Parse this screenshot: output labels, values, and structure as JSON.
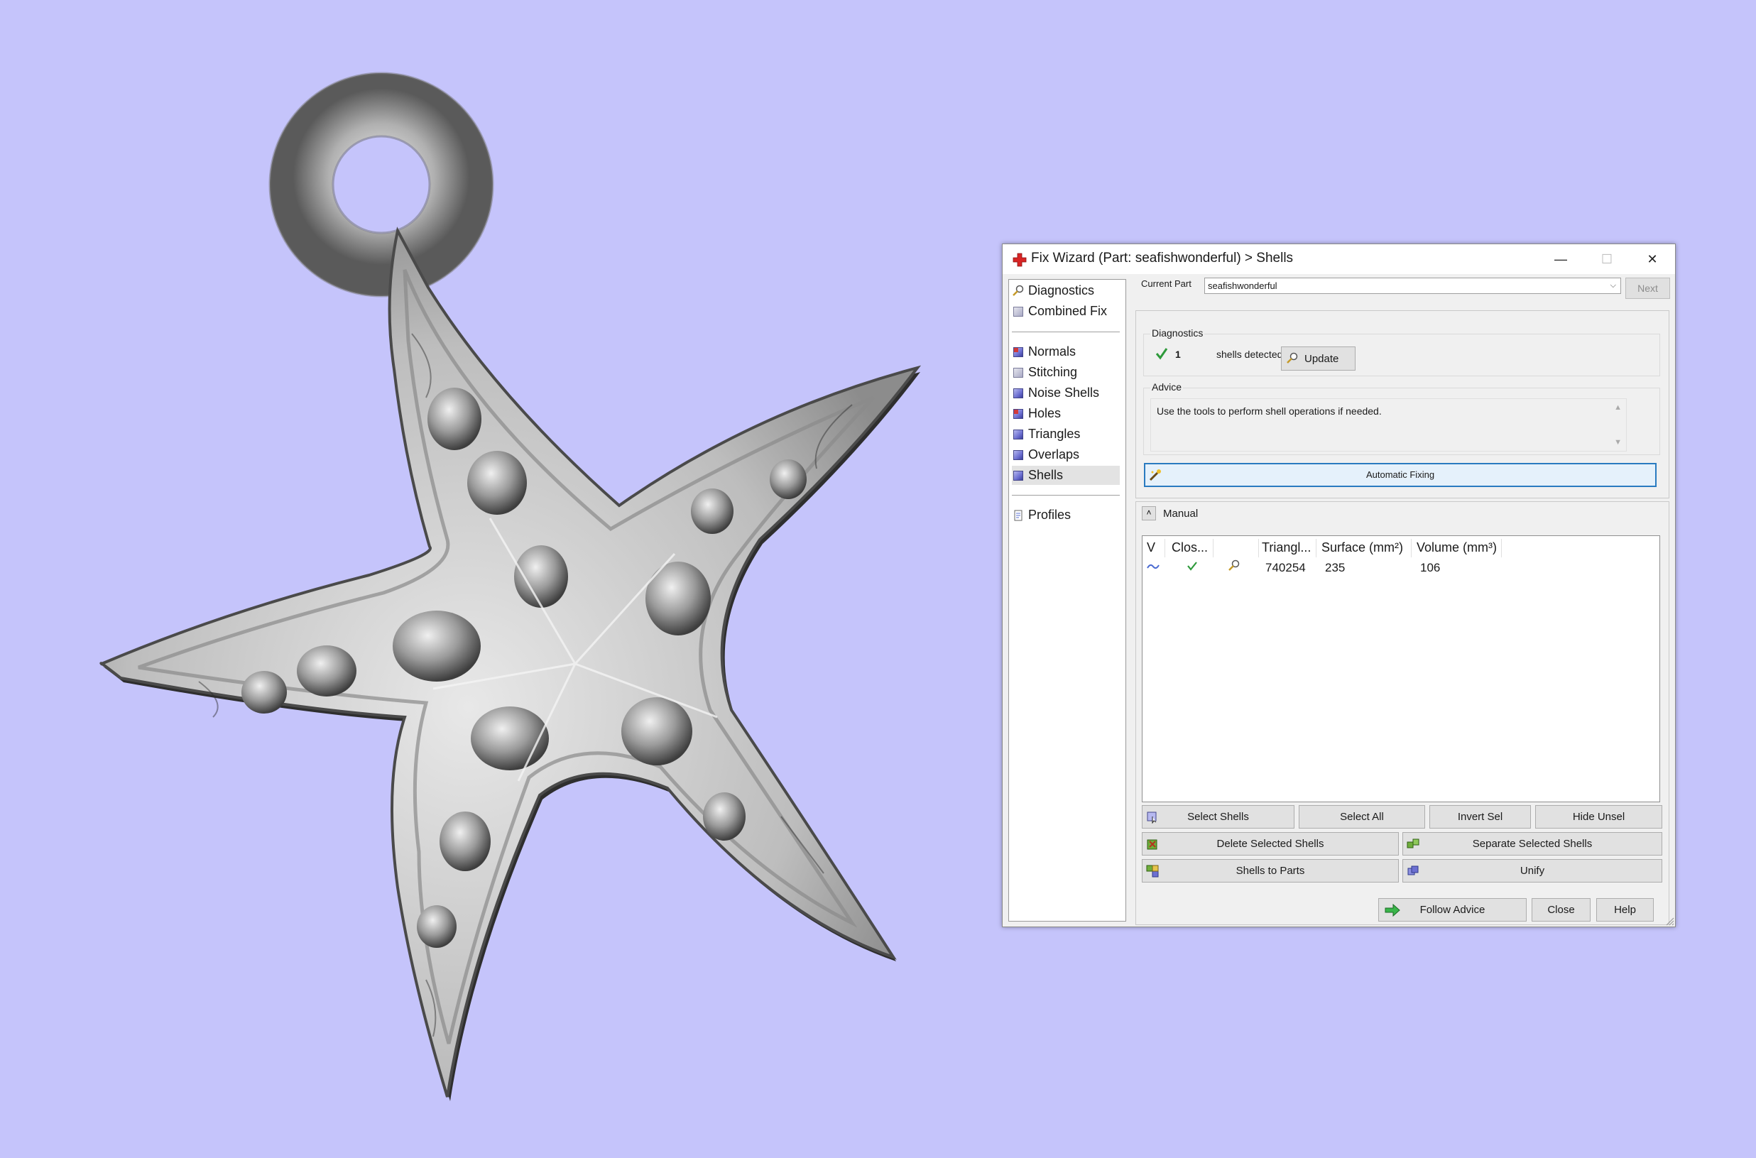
{
  "dialog": {
    "title": "Fix Wizard (Part: seafishwonderful) > Shells",
    "minimize": "—",
    "maximize": "☐",
    "close": "✕"
  },
  "nav": {
    "items": [
      {
        "label": "Diagnostics",
        "icon": "magnifier-icon"
      },
      {
        "label": "Combined Fix",
        "icon": "cube-icon"
      },
      {
        "label": "Normals",
        "icon": "normals-cube-icon"
      },
      {
        "label": "Stitching",
        "icon": "stitching-cube-icon"
      },
      {
        "label": "Noise Shells",
        "icon": "noise-shells-cube-icon"
      },
      {
        "label": "Holes",
        "icon": "holes-cube-icon"
      },
      {
        "label": "Triangles",
        "icon": "triangles-cube-icon"
      },
      {
        "label": "Overlaps",
        "icon": "overlaps-cube-icon"
      },
      {
        "label": "Shells",
        "icon": "shells-cube-icon",
        "selected": true
      },
      {
        "label": "Profiles",
        "icon": "document-icon"
      }
    ]
  },
  "top": {
    "current_part_label": "Current Part",
    "current_part_value": "seafishwonderful",
    "next_label": "Next"
  },
  "diagnostics": {
    "group_label": "Diagnostics",
    "count": "1",
    "status_text": "shells detected",
    "update_label": "Update"
  },
  "advice": {
    "group_label": "Advice",
    "text": "Use the tools to perform shell operations if needed.",
    "auto_fix_label": "Automatic Fixing"
  },
  "manual": {
    "label": "Manual",
    "columns": [
      "V",
      "Clos...",
      "",
      "Triangl...",
      "Surface (mm²)",
      "Volume (mm³)"
    ],
    "rows": [
      {
        "triangles": "740254",
        "surface": "235",
        "volume": "106"
      }
    ]
  },
  "buttons": {
    "select_shells": "Select Shells",
    "select_all": "Select All",
    "invert_sel": "Invert Sel",
    "hide_unsel": "Hide Unsel",
    "delete_selected": "Delete Selected Shells",
    "separate_selected": "Separate Selected Shells",
    "shells_to_parts": "Shells to Parts",
    "unify": "Unify",
    "follow_advice": "Follow Advice",
    "close": "Close",
    "help": "Help"
  },
  "colors": {
    "background": "#c5c4fb",
    "accent": "#2a7bc0",
    "check": "#2e9a3b"
  }
}
